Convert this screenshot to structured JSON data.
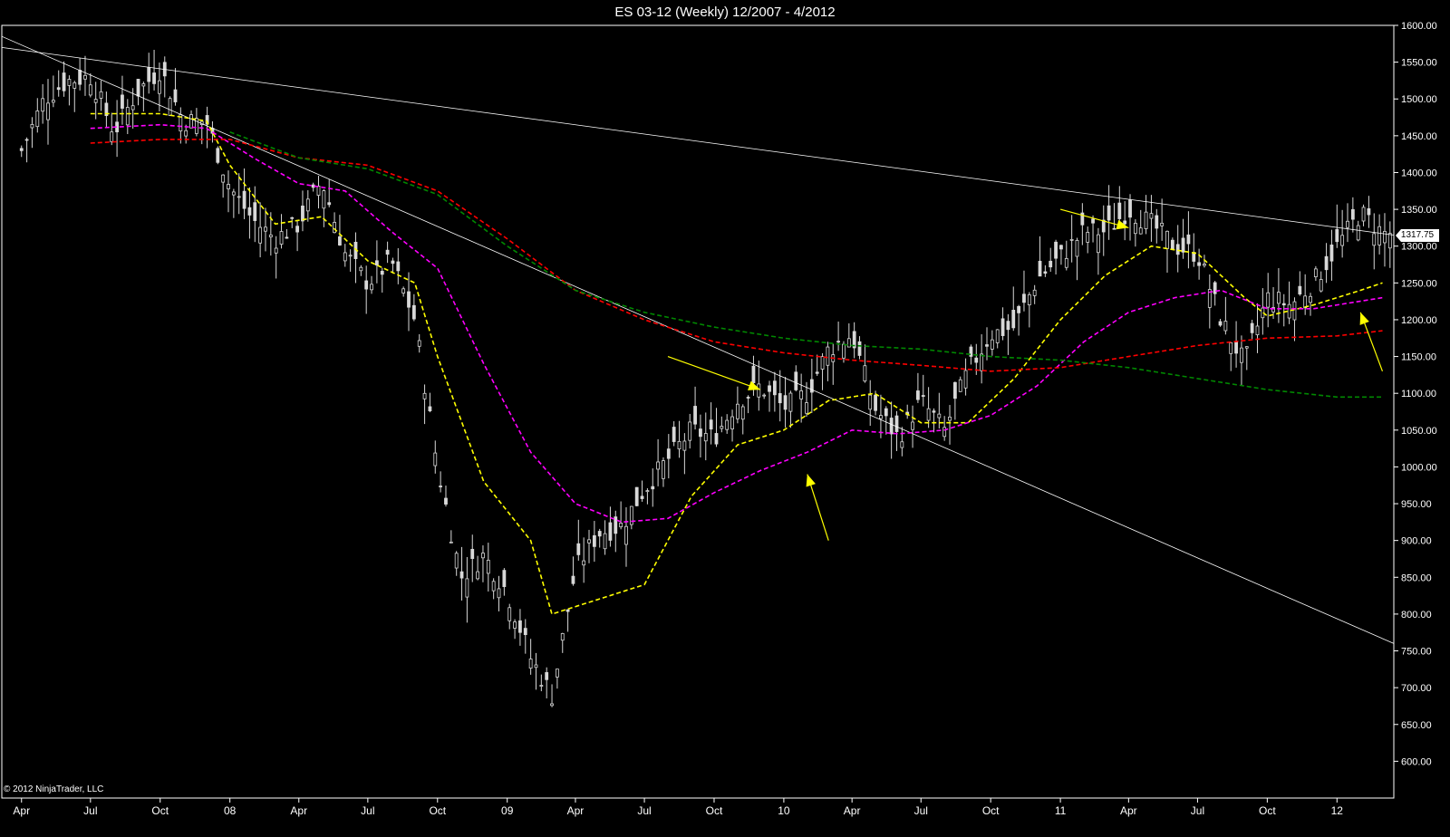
{
  "title": "ES 03-12 (Weekly)  12/2007 - 4/2012",
  "credit": "© 2012 NinjaTrader, LLC",
  "last_price_label": "1317.75",
  "colors": {
    "background": "#000000",
    "candle": "#d8d8d8",
    "ma_fast": "#ffff00",
    "ma_mid": "#ff00ff",
    "ma_slow": "#ff0000",
    "ma_long": "#008800",
    "trendline": "#ffffff",
    "arrow": "#ffff00"
  },
  "chart_data": {
    "type": "candlestick",
    "title": "ES 03-12 (Weekly)  12/2007 - 4/2012",
    "ylim": [
      550,
      1600
    ],
    "y_ticks": [
      "1600.00",
      "1550.00",
      "1500.00",
      "1450.00",
      "1400.00",
      "1350.00",
      "1300.00",
      "1250.00",
      "1200.00",
      "1150.00",
      "1100.00",
      "1050.00",
      "1000.00",
      "950.00",
      "900.00",
      "850.00",
      "800.00",
      "750.00",
      "700.00",
      "650.00",
      "600.00"
    ],
    "x_ticks": [
      "Apr",
      "Jul",
      "Oct",
      "08",
      "Apr",
      "Jul",
      "Oct",
      "09",
      "Apr",
      "Jul",
      "Oct",
      "10",
      "Apr",
      "Jul",
      "Oct",
      "11",
      "Apr",
      "Jul",
      "Oct",
      "12"
    ],
    "x_tick_dates": [
      "2007-04",
      "2007-07",
      "2007-10",
      "2008-01",
      "2008-04",
      "2008-07",
      "2008-10",
      "2009-01",
      "2009-04",
      "2009-07",
      "2009-10",
      "2010-01",
      "2010-04",
      "2010-07",
      "2010-10",
      "2011-01",
      "2011-04",
      "2011-07",
      "2011-10",
      "2012-01"
    ],
    "x_range": [
      "2007-03-20",
      "2012-03-30"
    ],
    "close_path": [
      [
        "2007-04",
        1430
      ],
      [
        "2007-05",
        1500
      ],
      [
        "2007-06",
        1525
      ],
      [
        "2007-07",
        1530
      ],
      [
        "2007-08",
        1455
      ],
      [
        "2007-09",
        1510
      ],
      [
        "2007-10",
        1540
      ],
      [
        "2007-11",
        1470
      ],
      [
        "2007-12",
        1470
      ],
      [
        "2008-01",
        1380
      ],
      [
        "2008-02",
        1335
      ],
      [
        "2008-03",
        1310
      ],
      [
        "2008-04",
        1330
      ],
      [
        "2008-05",
        1390
      ],
      [
        "2008-06",
        1290
      ],
      [
        "2008-07",
        1250
      ],
      [
        "2008-08",
        1280
      ],
      [
        "2008-09",
        1200
      ],
      [
        "2008-10",
        1000
      ],
      [
        "2008-11",
        850
      ],
      [
        "2008-12",
        880
      ],
      [
        "2009-01",
        830
      ],
      [
        "2009-02",
        740
      ],
      [
        "2009-03",
        690
      ],
      [
        "2009-04",
        860
      ],
      [
        "2009-05",
        910
      ],
      [
        "2009-06",
        920
      ],
      [
        "2009-07",
        970
      ],
      [
        "2009-08",
        1010
      ],
      [
        "2009-09",
        1050
      ],
      [
        "2009-10",
        1040
      ],
      [
        "2009-11",
        1090
      ],
      [
        "2009-12",
        1110
      ],
      [
        "2010-01",
        1080
      ],
      [
        "2010-02",
        1100
      ],
      [
        "2010-03",
        1160
      ],
      [
        "2010-04",
        1180
      ],
      [
        "2010-05",
        1080
      ],
      [
        "2010-06",
        1040
      ],
      [
        "2010-07",
        1090
      ],
      [
        "2010-08",
        1050
      ],
      [
        "2010-09",
        1130
      ],
      [
        "2010-10",
        1180
      ],
      [
        "2010-11",
        1190
      ],
      [
        "2010-12",
        1255
      ],
      [
        "2011-01",
        1285
      ],
      [
        "2011-02",
        1320
      ],
      [
        "2011-03",
        1320
      ],
      [
        "2011-04",
        1350
      ],
      [
        "2011-05",
        1330
      ],
      [
        "2011-06",
        1300
      ],
      [
        "2011-07",
        1290
      ],
      [
        "2011-08",
        1200
      ],
      [
        "2011-09",
        1140
      ],
      [
        "2011-10",
        1230
      ],
      [
        "2011-11",
        1220
      ],
      [
        "2011-12",
        1250
      ],
      [
        "2012-01",
        1300
      ],
      [
        "2012-02",
        1345
      ],
      [
        "2012-03",
        1317.75
      ]
    ],
    "series": [
      {
        "color": "#ffff00",
        "dashed": true,
        "values": [
          [
            "2007-07",
            1480
          ],
          [
            "2007-10",
            1480
          ],
          [
            "2007-12",
            1470
          ],
          [
            "2008-01",
            1410
          ],
          [
            "2008-03",
            1330
          ],
          [
            "2008-05",
            1340
          ],
          [
            "2008-07",
            1280
          ],
          [
            "2008-09",
            1250
          ],
          [
            "2008-10",
            1150
          ],
          [
            "2008-12",
            980
          ],
          [
            "2009-02",
            900
          ],
          [
            "2009-03",
            800
          ],
          [
            "2009-05",
            820
          ],
          [
            "2009-07",
            840
          ],
          [
            "2009-09",
            960
          ],
          [
            "2009-11",
            1030
          ],
          [
            "2010-01",
            1050
          ],
          [
            "2010-03",
            1090
          ],
          [
            "2010-05",
            1100
          ],
          [
            "2010-07",
            1060
          ],
          [
            "2010-09",
            1060
          ],
          [
            "2010-11",
            1120
          ],
          [
            "2011-01",
            1200
          ],
          [
            "2011-03",
            1260
          ],
          [
            "2011-05",
            1300
          ],
          [
            "2011-07",
            1290
          ],
          [
            "2011-09",
            1230
          ],
          [
            "2011-10",
            1205
          ],
          [
            "2011-12",
            1220
          ],
          [
            "2012-02",
            1240
          ],
          [
            "2012-03",
            1250
          ]
        ]
      },
      {
        "color": "#ff00ff",
        "dashed": true,
        "values": [
          [
            "2007-07",
            1460
          ],
          [
            "2007-10",
            1465
          ],
          [
            "2007-12",
            1460
          ],
          [
            "2008-02",
            1420
          ],
          [
            "2008-04",
            1385
          ],
          [
            "2008-06",
            1375
          ],
          [
            "2008-08",
            1320
          ],
          [
            "2008-10",
            1270
          ],
          [
            "2008-12",
            1140
          ],
          [
            "2009-02",
            1020
          ],
          [
            "2009-04",
            950
          ],
          [
            "2009-06",
            925
          ],
          [
            "2009-08",
            930
          ],
          [
            "2009-10",
            965
          ],
          [
            "2009-12",
            995
          ],
          [
            "2010-02",
            1020
          ],
          [
            "2010-04",
            1050
          ],
          [
            "2010-06",
            1045
          ],
          [
            "2010-08",
            1050
          ],
          [
            "2010-10",
            1070
          ],
          [
            "2010-12",
            1110
          ],
          [
            "2011-02",
            1170
          ],
          [
            "2011-04",
            1210
          ],
          [
            "2011-06",
            1230
          ],
          [
            "2011-08",
            1240
          ],
          [
            "2011-10",
            1215
          ],
          [
            "2011-12",
            1215
          ],
          [
            "2012-03",
            1230
          ]
        ]
      },
      {
        "color": "#ff0000",
        "dashed": true,
        "values": [
          [
            "2007-07",
            1440
          ],
          [
            "2007-10",
            1445
          ],
          [
            "2008-01",
            1445
          ],
          [
            "2008-04",
            1420
          ],
          [
            "2008-07",
            1410
          ],
          [
            "2008-10",
            1375
          ],
          [
            "2009-01",
            1310
          ],
          [
            "2009-04",
            1240
          ],
          [
            "2009-07",
            1200
          ],
          [
            "2009-10",
            1170
          ],
          [
            "2010-01",
            1155
          ],
          [
            "2010-04",
            1145
          ],
          [
            "2010-07",
            1138
          ],
          [
            "2010-10",
            1130
          ],
          [
            "2011-01",
            1135
          ],
          [
            "2011-04",
            1150
          ],
          [
            "2011-07",
            1165
          ],
          [
            "2011-10",
            1175
          ],
          [
            "2012-01",
            1178
          ],
          [
            "2012-03",
            1185
          ]
        ]
      },
      {
        "color": "#008800",
        "dashed": true,
        "values": [
          [
            "2008-01",
            1455
          ],
          [
            "2008-04",
            1420
          ],
          [
            "2008-07",
            1405
          ],
          [
            "2008-10",
            1370
          ],
          [
            "2009-01",
            1300
          ],
          [
            "2009-04",
            1240
          ],
          [
            "2009-07",
            1210
          ],
          [
            "2009-10",
            1190
          ],
          [
            "2010-01",
            1175
          ],
          [
            "2010-04",
            1165
          ],
          [
            "2010-07",
            1160
          ],
          [
            "2010-10",
            1150
          ],
          [
            "2011-01",
            1145
          ],
          [
            "2011-04",
            1135
          ],
          [
            "2011-07",
            1120
          ],
          [
            "2011-10",
            1105
          ],
          [
            "2012-01",
            1095
          ],
          [
            "2012-03",
            1095
          ]
        ]
      }
    ],
    "trendlines": [
      {
        "color": "#ffffff",
        "from": [
          "2007-03-20",
          1570
        ],
        "to": [
          "2012-03-30",
          1315
        ]
      },
      {
        "color": "#ffffff",
        "from": [
          "2007-03-20",
          1585
        ],
        "to": [
          "2012-03-30",
          760
        ]
      }
    ],
    "arrows": [
      {
        "color": "#ffff00",
        "from": [
          "2009-08",
          1150
        ],
        "to": [
          "2009-12",
          1105
        ]
      },
      {
        "color": "#ffff00",
        "from": [
          "2010-03",
          900
        ],
        "to": [
          "2010-02",
          990
        ]
      },
      {
        "color": "#ffff00",
        "from": [
          "2011-01",
          1350
        ],
        "to": [
          "2011-04",
          1325
        ]
      },
      {
        "color": "#ffff00",
        "from": [
          "2012-03",
          1130
        ],
        "to": [
          "2012-02",
          1210
        ]
      }
    ]
  }
}
